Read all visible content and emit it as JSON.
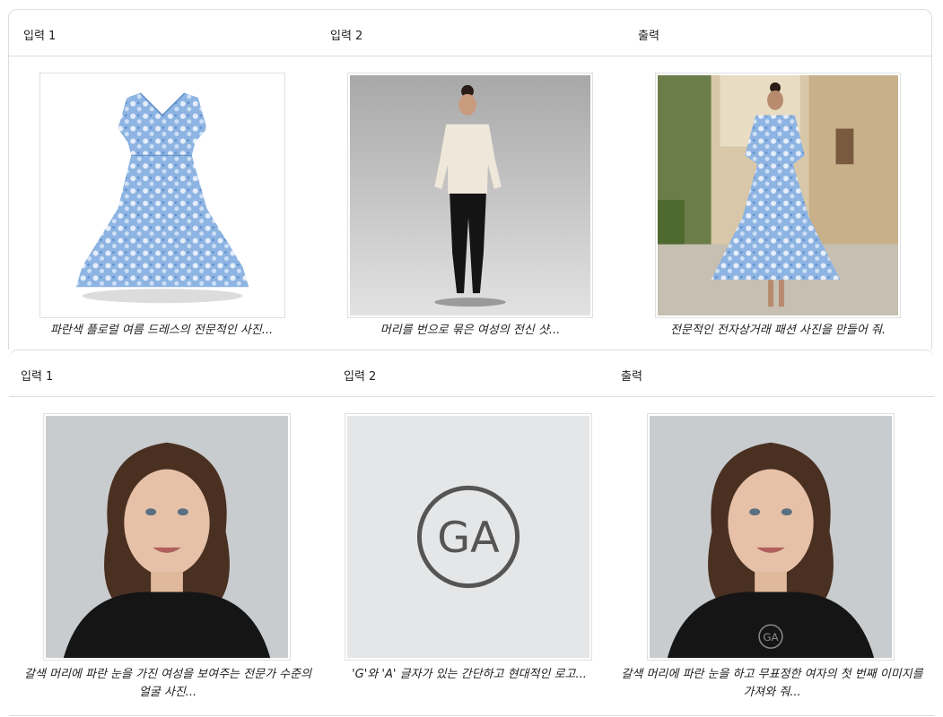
{
  "row1": {
    "headers": {
      "input1": "입력 1",
      "input2": "입력 2",
      "output": "출력"
    },
    "captions": {
      "input1": "파란색 플로럴 여름 드레스의 전문적인 사진...",
      "input2": "머리를 번으로 묶은 여성의 전신 샷...",
      "output": "전문적인 전자상거래 패션 사진을 만들어 줘."
    }
  },
  "row2": {
    "headers": {
      "input1": "입력 1",
      "input2": "입력 2",
      "output": "출력"
    },
    "captions": {
      "input1": "갈색 머리에 파란 눈을 가진 여성을 보여주는 전문가 수준의 얼굴 사진...",
      "input2": "'G'와 'A' 글자가 있는 간단하고 현대적인 로고...",
      "output": "갈색 머리에 파란 눈을 하고 무표정한 여자의 첫 번째 이미지를 가져와 줘..."
    },
    "logo_text": "GA"
  },
  "colors": {
    "border": "#dadce0",
    "dress_blue": "#7fa9d9",
    "text": "#202124"
  }
}
